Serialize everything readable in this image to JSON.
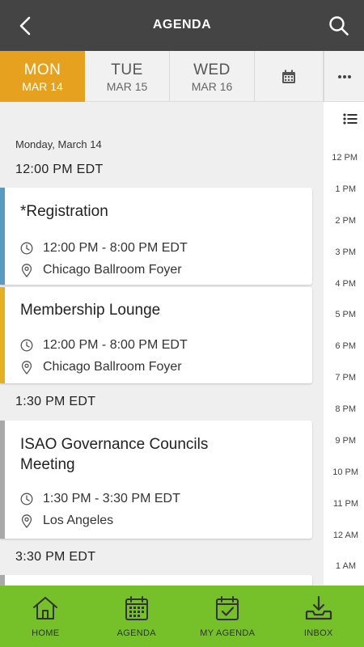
{
  "header": {
    "title": "AGENDA"
  },
  "day_tabs": [
    {
      "dow": "MON",
      "date": "MAR 14"
    },
    {
      "dow": "TUE",
      "date": "MAR 15"
    },
    {
      "dow": "WED",
      "date": "MAR 16"
    }
  ],
  "day_heading": "Monday, March 14",
  "groups": [
    {
      "time": "12:00 PM EDT",
      "sessions": [
        {
          "title": "*Registration",
          "time": "12:00 PM - 8:00 PM EDT",
          "location": "Chicago Ballroom Foyer",
          "color": "#5b9ac0"
        },
        {
          "title": "Membership Lounge",
          "time": "12:00 PM - 8:00 PM EDT",
          "location": "Chicago Ballroom Foyer",
          "color": "#e2b020"
        }
      ]
    },
    {
      "time": "1:30 PM EDT",
      "sessions": [
        {
          "title_line1": "ISAO Governance Councils",
          "title_line2": "Meeting",
          "time": "1:30 PM - 3:30 PM EDT",
          "location": "Los Angeles",
          "color": "#a9a9a9"
        }
      ]
    },
    {
      "time": "3:30 PM EDT"
    }
  ],
  "timeline": [
    "12 PM",
    "1 PM",
    "2 PM",
    "3 PM",
    "4 PM",
    "5 PM",
    "6 PM",
    "7 PM",
    "8 PM",
    "9 PM",
    "10 PM",
    "11 PM",
    "12 AM",
    "1 AM"
  ],
  "nav": [
    {
      "label": "HOME"
    },
    {
      "label": "AGENDA"
    },
    {
      "label": "MY AGENDA"
    },
    {
      "label": "INBOX"
    }
  ],
  "colors": {
    "accent": "#e6a21e",
    "topbar": "#444444",
    "bottombar": "#76c12a"
  }
}
